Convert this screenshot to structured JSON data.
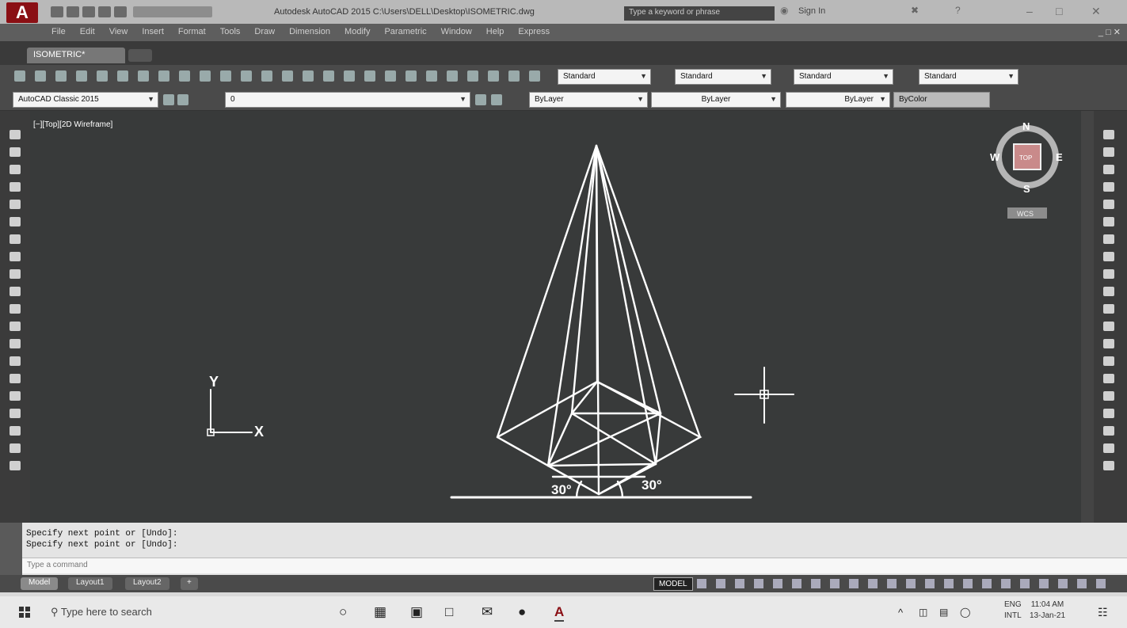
{
  "window": {
    "title": "Autodesk AutoCAD 2015   C:\\Users\\DELL\\Desktop\\ISOMETRIC.dwg",
    "search_placeholder": "Type a keyword or phrase",
    "sign_in": "Sign In",
    "logo": "A"
  },
  "menu": [
    "File",
    "Edit",
    "View",
    "Insert",
    "Format",
    "Tools",
    "Draw",
    "Dimension",
    "Modify",
    "Parametric",
    "Window",
    "Help",
    "Express"
  ],
  "doc_tab": "ISOMETRIC*",
  "toolbar": {
    "text_style": "Standard",
    "dim_style": "Standard",
    "table_style": "Standard",
    "mleader_style": "Standard",
    "workspace": "AutoCAD Classic 2015",
    "layer": "0",
    "color": "ByLayer",
    "linetype": "ByLayer",
    "lineweight": "ByLayer",
    "plotstyle": "ByColor"
  },
  "viewport": {
    "label": "[−][Top][2D Wireframe]",
    "ucs_y": "Y",
    "ucs_x": "X",
    "angle_left": "30°",
    "angle_right": "30°",
    "viewcube": {
      "n": "N",
      "s": "S",
      "e": "E",
      "w": "W",
      "face": "TOP",
      "wcs": "WCS"
    }
  },
  "command": {
    "history": [
      "Specify next point or [Undo]:",
      "Specify next point or [Undo]:"
    ],
    "placeholder": "Type a command"
  },
  "status": {
    "layouts": [
      "Model",
      "Layout1",
      "Layout2"
    ],
    "model_button": "MODEL"
  },
  "taskbar": {
    "search_placeholder": "Type here to search",
    "lang1": "ENG",
    "lang2": "INTL",
    "time": "11:04 AM",
    "date": "13-Jan-21"
  },
  "colors": {
    "viewport_bg": "#383a3a",
    "drawing_lines": "#ffffff",
    "logo_red": "#8a0f14"
  }
}
